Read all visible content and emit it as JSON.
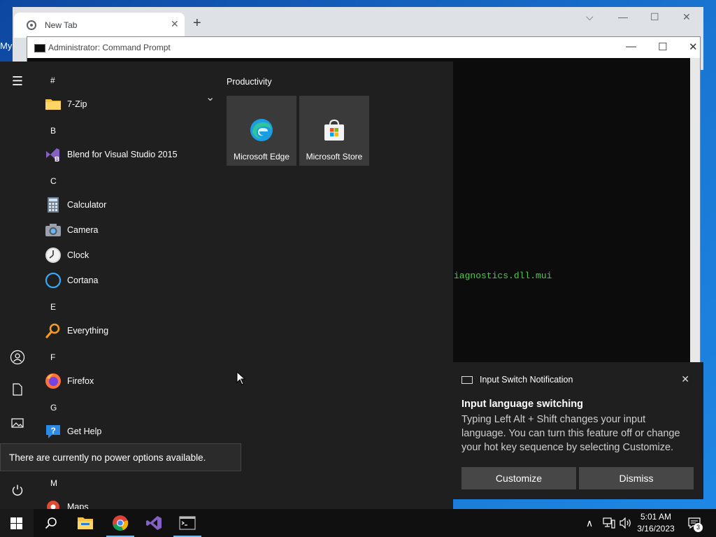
{
  "desktop": {
    "label": "My"
  },
  "chrome": {
    "tab_title": "New Tab",
    "tab_close": "✕",
    "new_tab": "+",
    "minimize": "⌵",
    "minimize2": "—",
    "maximize": "☐",
    "close": "✕"
  },
  "cmd": {
    "title": "Administrator:  Command Prompt",
    "minimize": "—",
    "maximize": "☐",
    "close": "✕",
    "output_fragment": "iagnostics.dll.mui"
  },
  "start": {
    "rail": {
      "menu": "☰",
      "user": "👤",
      "documents": "🗋",
      "pictures": "🖼",
      "power": "⏻"
    },
    "groups": [
      {
        "letter": "#",
        "apps": [
          {
            "label": "7-Zip",
            "icon": "folder-icon"
          }
        ]
      },
      {
        "letter": "B",
        "apps": [
          {
            "label": "Blend for Visual Studio 2015",
            "icon": "blend-icon"
          }
        ]
      },
      {
        "letter": "C",
        "apps": [
          {
            "label": "Calculator",
            "icon": "calculator-icon"
          },
          {
            "label": "Camera",
            "icon": "camera-icon"
          },
          {
            "label": "Clock",
            "icon": "clock-icon"
          },
          {
            "label": "Cortana",
            "icon": "cortana-icon"
          }
        ]
      },
      {
        "letter": "E",
        "apps": [
          {
            "label": "Everything",
            "icon": "search-icon"
          }
        ]
      },
      {
        "letter": "F",
        "apps": [
          {
            "label": "Firefox",
            "icon": "firefox-icon"
          }
        ]
      },
      {
        "letter": "G",
        "apps": [
          {
            "label": "Get Help",
            "icon": "help-icon"
          }
        ]
      },
      {
        "letter": "M",
        "apps": [
          {
            "label": "Maps",
            "icon": "maps-icon"
          }
        ]
      }
    ],
    "chevron": "⌄",
    "tiles_header": "Productivity",
    "tiles": [
      {
        "label": "Microsoft Edge",
        "icon": "edge-icon"
      },
      {
        "label": "Microsoft Store",
        "icon": "store-icon"
      }
    ],
    "power_tooltip": "There are currently no power options available."
  },
  "notification": {
    "app": "Input Switch Notification",
    "close": "✕",
    "title": "Input language switching",
    "body": "Typing Left Alt + Shift changes your input language. You can turn this feature off or change your hot key sequence by selecting Customize.",
    "buttons": {
      "customize": "Customize",
      "dismiss": "Dismiss"
    }
  },
  "taskbar": {
    "tray": {
      "chevron": "∧",
      "network": "🖧",
      "volume": "🔈"
    },
    "time": "5:01 AM",
    "date": "3/16/2023",
    "notification_count": "3"
  },
  "colors": {
    "accent": "#0078d7",
    "cmd_text": "#4ec94e",
    "start_bg": "#1f1f1f",
    "taskbar_bg": "#101010"
  }
}
